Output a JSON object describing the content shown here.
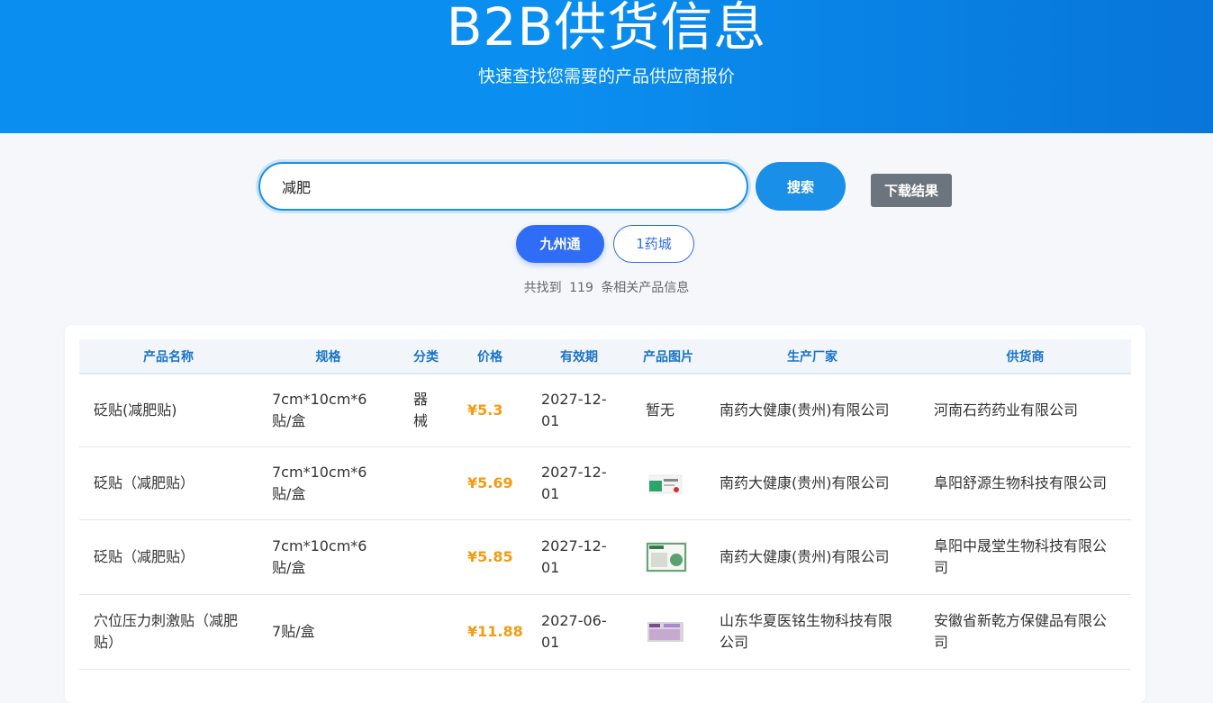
{
  "header": {
    "title": "B2B供货信息",
    "subtitle": "快速查找您需要的产品供应商报价"
  },
  "search": {
    "value": "减肥",
    "button_label": "搜索",
    "download_label": "下载结果"
  },
  "sources": {
    "tabs": [
      {
        "label": "九州通",
        "active": true
      },
      {
        "label": "1药城",
        "active": false
      }
    ]
  },
  "result": {
    "prefix": "共找到",
    "count": "119",
    "suffix": "条相关产品信息"
  },
  "table": {
    "columns": [
      "产品名称",
      "规格",
      "分类",
      "价格",
      "有效期",
      "产品图片",
      "生产厂家",
      "供货商"
    ],
    "rows": [
      {
        "name": "砭贴(减肥贴)",
        "spec": "7cm*10cm*6贴/盒",
        "category": "器械",
        "price": "¥5.3",
        "expiry": "2027-12-01",
        "image": "暂无",
        "manufacturer": "南药大健康(贵州)有限公司",
        "supplier": "河南石药药业有限公司"
      },
      {
        "name": "砭贴（减肥贴）",
        "spec": "7cm*10cm*6贴/盒",
        "category": "",
        "price": "¥5.69",
        "expiry": "2027-12-01",
        "image": "",
        "manufacturer": "南药大健康(贵州)有限公司",
        "supplier": "阜阳舒源生物科技有限公司"
      },
      {
        "name": "砭贴（减肥贴）",
        "spec": "7cm*10cm*6贴/盒",
        "category": "",
        "price": "¥5.85",
        "expiry": "2027-12-01",
        "image": "",
        "manufacturer": "南药大健康(贵州)有限公司",
        "supplier": "阜阳中晟堂生物科技有限公司"
      },
      {
        "name": "穴位压力刺激贴（减肥贴）",
        "spec": "7贴/盒",
        "category": "",
        "price": "¥11.88",
        "expiry": "2027-06-01",
        "image": "",
        "manufacturer": "山东华夏医铭生物科技有限公司",
        "supplier": "安徽省新乾方保健品有限公司"
      }
    ]
  },
  "colors": {
    "primary": "#1a8fe8",
    "tab_active": "#2f6df6",
    "price": "#f39c12",
    "header_text": "#1a73c8",
    "download_bg": "#6c757d"
  }
}
